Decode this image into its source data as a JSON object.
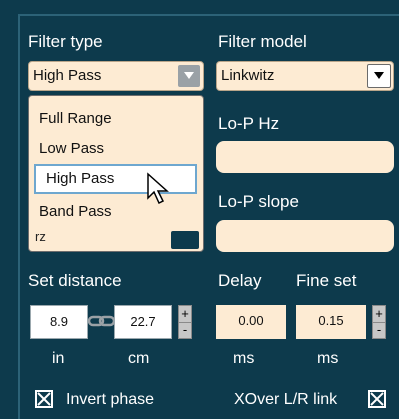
{
  "filter_type": {
    "label": "Filter type",
    "selected": "High Pass",
    "options": [
      "Full Range",
      "Low Pass",
      "High Pass",
      "Band Pass"
    ],
    "partial_option": "rz"
  },
  "filter_model": {
    "label": "Filter model",
    "selected": "Linkwitz"
  },
  "lop_hz": {
    "label": "Lo-P Hz",
    "value": ""
  },
  "lop_slope": {
    "label": "Lo-P slope",
    "value": ""
  },
  "set_distance": {
    "label": "Set distance",
    "inches": "8.9",
    "cm": "22.7",
    "unit_in": "in",
    "unit_cm": "cm"
  },
  "delay": {
    "label": "Delay",
    "value": "0.00",
    "unit": "ms"
  },
  "fine_set": {
    "label": "Fine set",
    "value": "0.15",
    "unit": "ms"
  },
  "stepper": {
    "plus": "+",
    "minus": "-"
  },
  "invert_phase": {
    "label": "Invert phase",
    "checked": true
  },
  "xover_link": {
    "label": "XOver L/R link",
    "checked": true
  },
  "colors": {
    "background": "#0d3a4c",
    "field": "#fdebd3",
    "selection_border": "#6ea7cf"
  }
}
